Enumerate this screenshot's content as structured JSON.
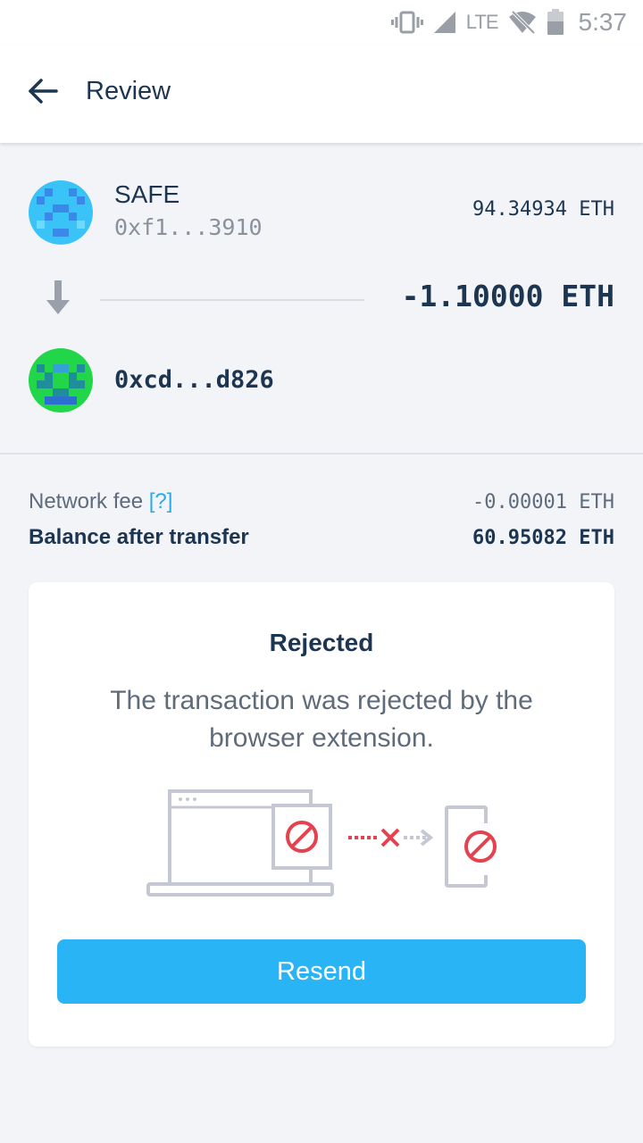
{
  "status_bar": {
    "network": "LTE",
    "time": "5:37",
    "icons": [
      "vibrate-icon",
      "signal-icon",
      "wifi-off-icon",
      "battery-icon"
    ]
  },
  "header": {
    "title": "Review",
    "back_icon": "arrow-left-icon"
  },
  "sender": {
    "name": "SAFE",
    "address": "0xf1...3910",
    "balance": "94.34934 ETH"
  },
  "transfer": {
    "amount": "-1.10000 ETH",
    "arrow_icon": "arrow-down-icon"
  },
  "recipient": {
    "address": "0xcd...d826"
  },
  "fees": {
    "network_fee_label": "Network fee",
    "help_label": "[?]",
    "network_fee_value": "-0.00001 ETH",
    "balance_after_label": "Balance after transfer",
    "balance_after_value": "60.95082 ETH"
  },
  "rejection_card": {
    "title": "Rejected",
    "message": "The transaction was rejected by the browser extension.",
    "button_label": "Resend"
  },
  "colors": {
    "accent": "#29b4f6",
    "primary_text": "#1c3550",
    "secondary_text": "#5f6b7a",
    "error": "#e5414f",
    "background": "#f2f4f8"
  }
}
